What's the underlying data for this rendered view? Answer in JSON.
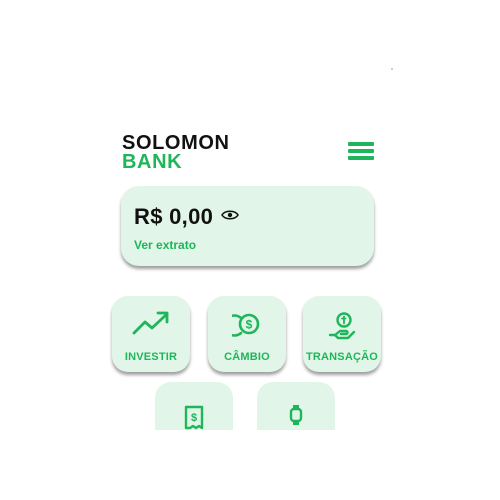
{
  "brand": {
    "line1": "SOLOMON",
    "line2": "BANK"
  },
  "header": {
    "menu_icon": "hamburger-menu-icon"
  },
  "balance": {
    "amount": "R$ 0,00",
    "visibility_icon": "eye-icon",
    "statement_link": "Ver extrato"
  },
  "actions": [
    {
      "label": "INVESTIR",
      "icon": "trend-up-icon"
    },
    {
      "label": "CÂMBIO",
      "icon": "coin-exchange-icon"
    },
    {
      "label": "TRANSAÇÃO",
      "icon": "hand-coin-icon"
    }
  ],
  "partial_actions": [
    {
      "icon": "receipt-icon"
    },
    {
      "icon": "smartwatch-icon"
    }
  ],
  "colors": {
    "accent": "#1fb55a",
    "card_background": "#e1f6e8",
    "text": "#111111"
  }
}
